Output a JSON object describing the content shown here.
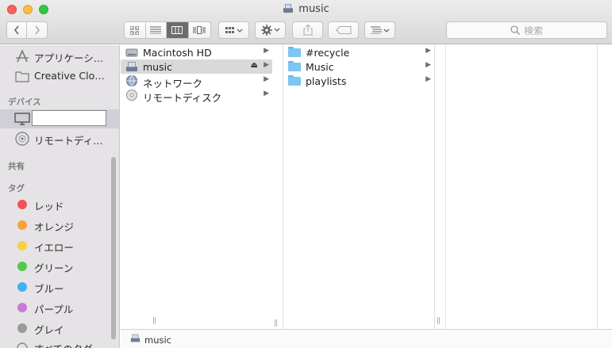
{
  "window": {
    "title": "music"
  },
  "toolbar": {
    "search_placeholder": "検索",
    "view_modes": [
      "icon-view-icon",
      "list-view-icon",
      "column-view-icon",
      "cover-flow-icon"
    ],
    "active_view": "column-view-icon"
  },
  "sidebar": {
    "items_top": [
      {
        "label": "アプリケーシ…",
        "icon": "applications-icon"
      },
      {
        "label": "Creative Clo…",
        "icon": "folder-icon"
      }
    ],
    "devices_header": "デバイス",
    "devices": [
      {
        "label": "",
        "icon": "computer-icon"
      },
      {
        "label": "リモートディ…",
        "icon": "remote-disc-icon"
      }
    ],
    "shared_header": "共有",
    "tags_header": "タグ",
    "tags": [
      {
        "label": "レッド",
        "color": "#f6525d"
      },
      {
        "label": "オレンジ",
        "color": "#f7a23f"
      },
      {
        "label": "イエロー",
        "color": "#f8ce45"
      },
      {
        "label": "グリーン",
        "color": "#57c84f"
      },
      {
        "label": "ブルー",
        "color": "#3fb1f2"
      },
      {
        "label": "パープル",
        "color": "#c87ada"
      },
      {
        "label": "グレイ",
        "color": "#9a9a9a"
      }
    ],
    "tags_more": "すべてのタグ…"
  },
  "columns": {
    "col1": [
      {
        "label": "Macintosh HD",
        "icon": "hard-drive-icon",
        "selected": false,
        "eject": false
      },
      {
        "label": "music",
        "icon": "network-drive-icon",
        "selected": true,
        "eject": true
      },
      {
        "label": "ネットワーク",
        "icon": "network-globe-icon",
        "selected": false,
        "eject": false
      },
      {
        "label": "リモートディスク",
        "icon": "remote-disc-icon",
        "selected": false,
        "eject": false
      }
    ],
    "col2": [
      {
        "label": "#recycle"
      },
      {
        "label": "Music"
      },
      {
        "label": "playlists"
      }
    ]
  },
  "pathbar": {
    "label": "music"
  }
}
